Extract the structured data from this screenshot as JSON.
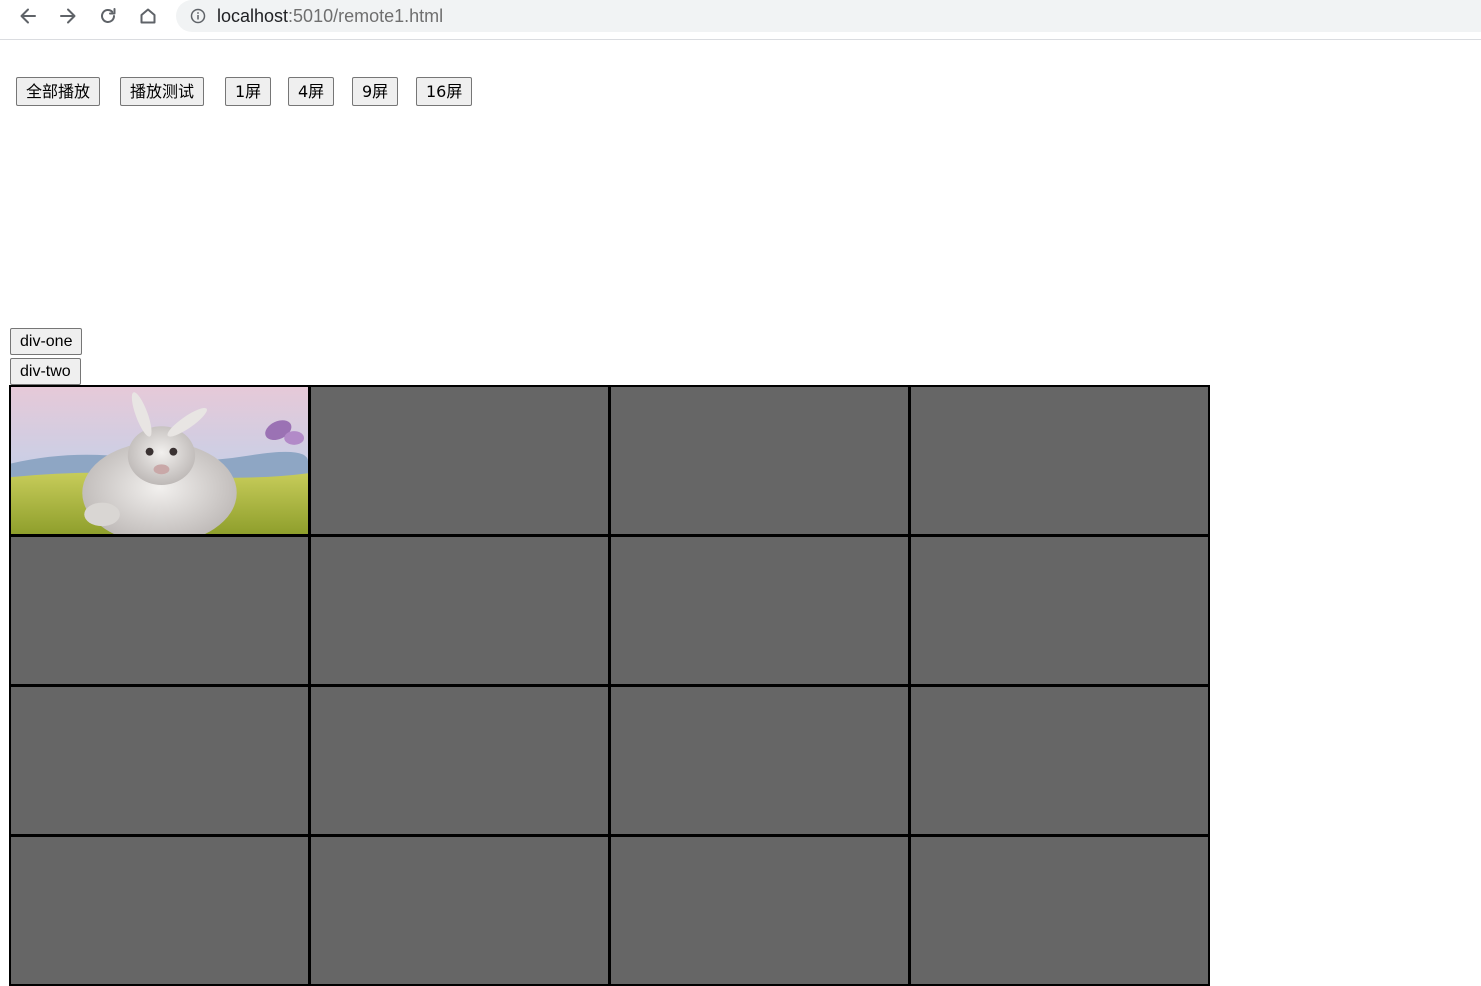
{
  "browser": {
    "url_host": "localhost",
    "url_path": ":5010/remote1.html"
  },
  "toolbar": {
    "buttons": [
      {
        "label": "全部播放"
      },
      {
        "label": "播放测试"
      },
      {
        "label": "1屏"
      },
      {
        "label": "4屏"
      },
      {
        "label": "9屏"
      },
      {
        "label": "16屏"
      }
    ]
  },
  "divs": {
    "one_label": "div-one",
    "two_label": "div-two"
  },
  "grid": {
    "rows": 4,
    "cols": 4,
    "playing_cell": 1,
    "cell_color": "#666666",
    "border_color": "#000000"
  },
  "icons": [
    "back-arrow-icon",
    "forward-arrow-icon",
    "reload-icon",
    "home-icon",
    "info-icon"
  ]
}
